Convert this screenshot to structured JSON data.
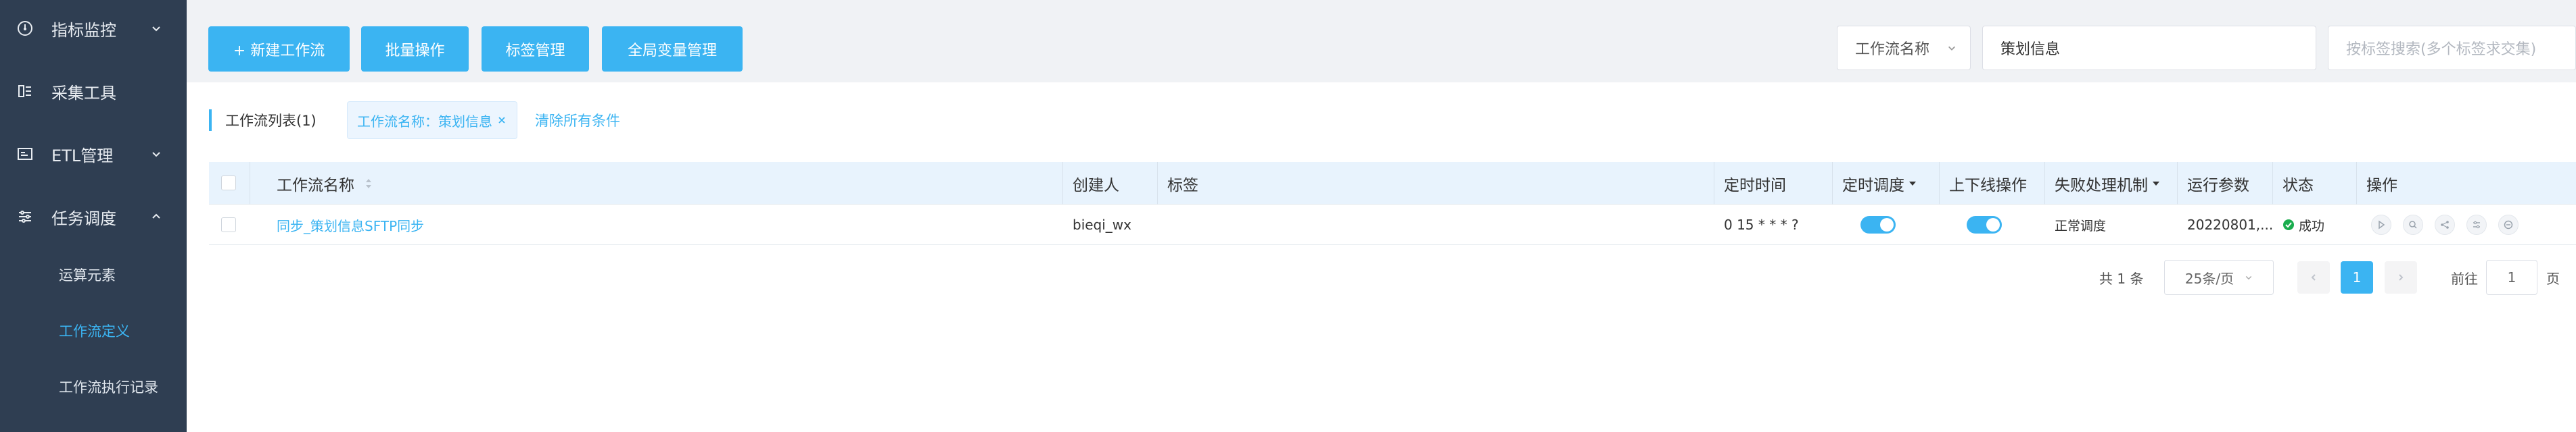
{
  "sidebar": {
    "items": [
      {
        "label": "指标监控",
        "icon": "gauge-icon",
        "expanded": false
      },
      {
        "label": "采集工具",
        "icon": "collect-icon"
      },
      {
        "label": "ETL管理",
        "icon": "etl-icon",
        "expanded": false
      },
      {
        "label": "任务调度",
        "icon": "schedule-icon",
        "expanded": true
      }
    ],
    "sub_items": [
      {
        "label": "运算元素",
        "active": false
      },
      {
        "label": "工作流定义",
        "active": true
      },
      {
        "label": "工作流执行记录",
        "active": false
      }
    ]
  },
  "toolbar": {
    "new_workflow": "+ 新建工作流",
    "batch": "批量操作",
    "tags": "标签管理",
    "global_vars": "全局变量管理"
  },
  "search": {
    "field_select": "工作流名称",
    "keyword": "策划信息",
    "tag_placeholder": "按标签搜索(多个标签求交集)"
  },
  "list": {
    "title": "工作流列表(1)",
    "filter_tag": "工作流名称：策划信息",
    "clear_all": "清除所有条件"
  },
  "table": {
    "headers": {
      "name": "工作流名称",
      "creator": "创建人",
      "tag": "标签",
      "time": "定时时间",
      "sched": "定时调度",
      "online": "上下线操作",
      "fail": "失败处理机制",
      "params": "运行参数",
      "status": "状态",
      "ops": "操作"
    },
    "rows": [
      {
        "name": "同步_策划信息SFTP同步",
        "creator": "bieqi_wx",
        "tag": "",
        "time": "0 15 * * * ?",
        "sched_on": true,
        "online_on": true,
        "fail": "正常调度",
        "params": "20220801,...",
        "status": "成功"
      }
    ]
  },
  "pagination": {
    "total": "共 1 条",
    "page_size": "25条/页",
    "current": "1",
    "goto_label": "前往",
    "goto_value": "1",
    "page_unit": "页"
  },
  "colors": {
    "accent": "#3bb4f2",
    "sidebar_bg": "#2f3e52",
    "success": "#1aad4e"
  }
}
